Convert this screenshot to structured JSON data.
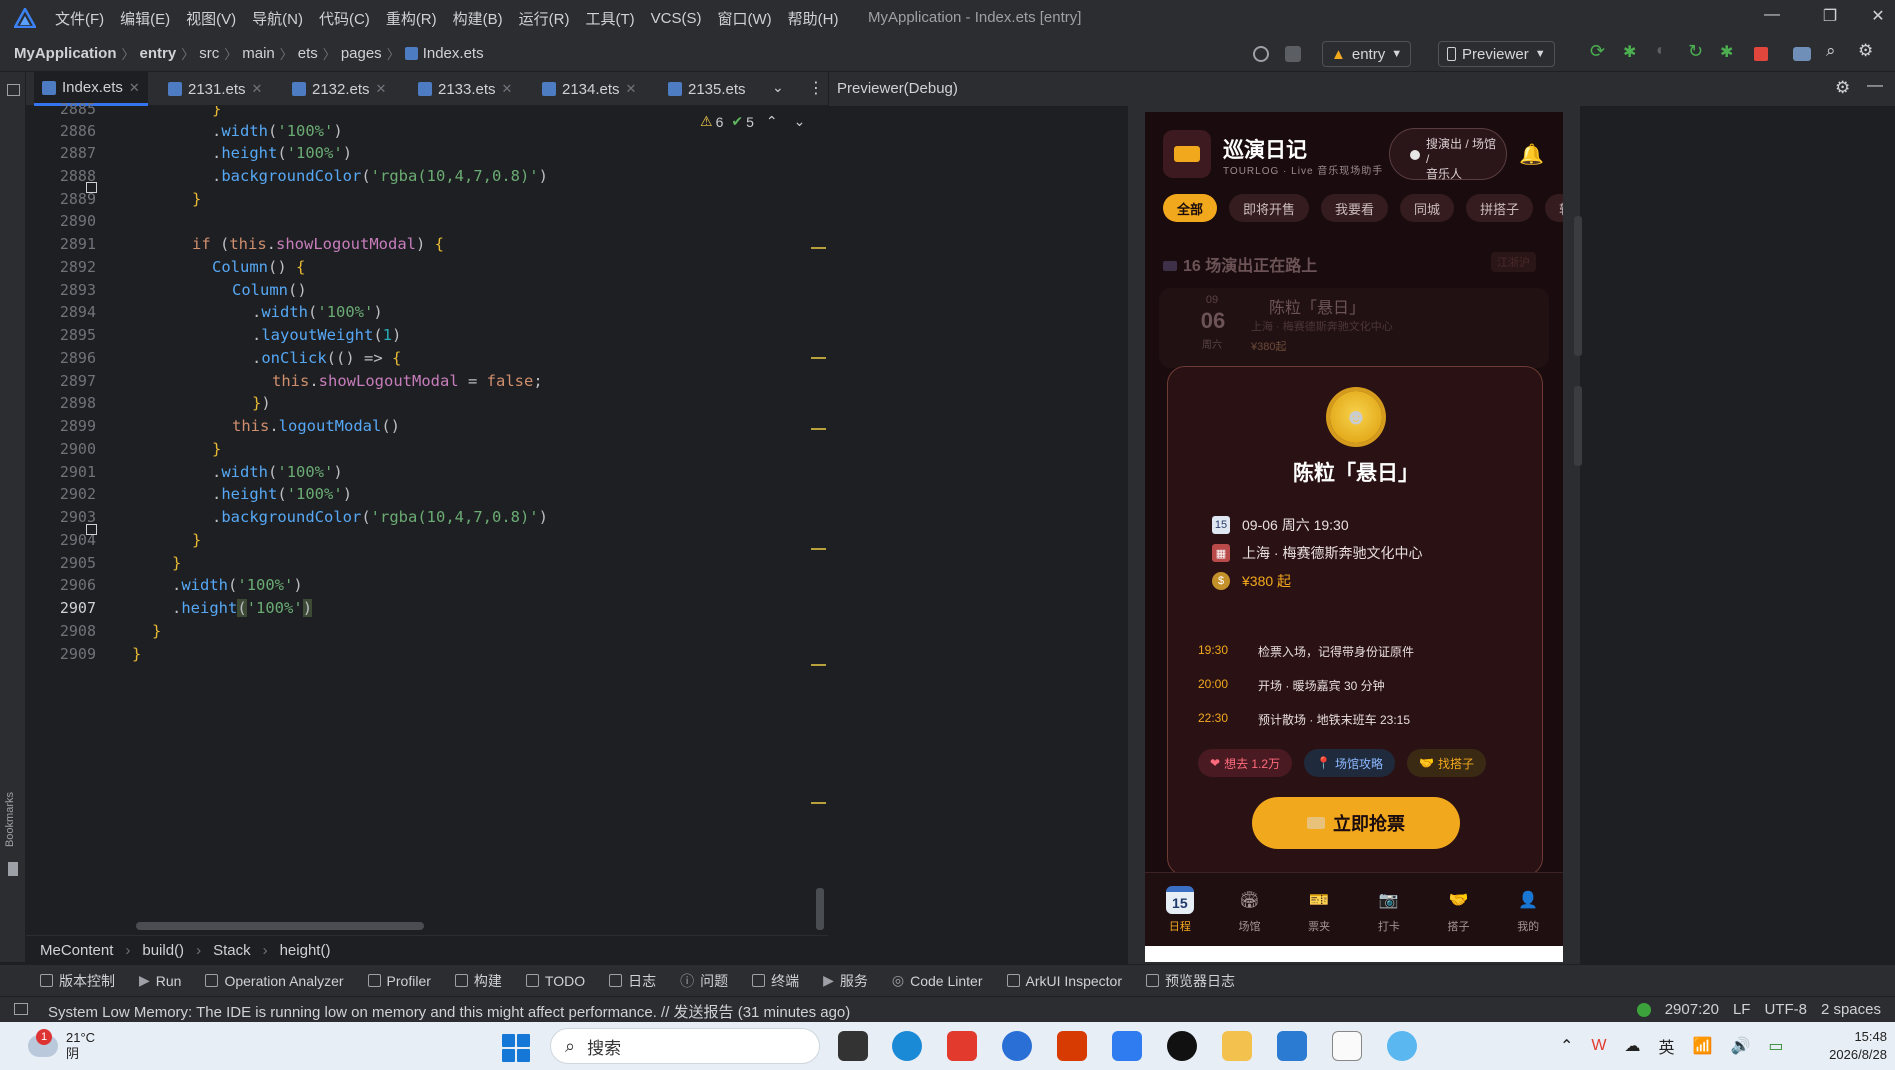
{
  "window": {
    "title": "MyApplication - Index.ets [entry]",
    "menus": [
      "文件(F)",
      "编辑(E)",
      "视图(V)",
      "导航(N)",
      "代码(C)",
      "重构(R)",
      "构建(B)",
      "运行(R)",
      "工具(T)",
      "VCS(S)",
      "窗口(W)",
      "帮助(H)"
    ]
  },
  "navbar": {
    "crumbs": [
      "MyApplication",
      "entry",
      "src",
      "main",
      "ets",
      "pages",
      "Index.ets"
    ],
    "module_select": "entry",
    "device_select": "Previewer"
  },
  "editor": {
    "tabs": [
      "Index.ets",
      "2131.ets",
      "2132.ets",
      "2133.ets",
      "2134.ets",
      "2135.ets"
    ],
    "active_tab": "Index.ets",
    "warnings": "6",
    "checks": "5",
    "line_numbers": [
      "2885",
      "2886",
      "2887",
      "2888",
      "2889",
      "2890",
      "2891",
      "2892",
      "2893",
      "2894",
      "2895",
      "2896",
      "2897",
      "2898",
      "2899",
      "2900",
      "2901",
      "2902",
      "2903",
      "2904",
      "2905",
      "2906",
      "2907",
      "2908",
      "2909"
    ],
    "current_line": "2907",
    "breadcrumbs": [
      "MeContent",
      "build()",
      "Stack",
      "height()"
    ]
  },
  "previewer": {
    "title": "Previewer(Debug)"
  },
  "app": {
    "name": "巡演日记",
    "subtitle": "TOURLOG · Live 音乐现场助手",
    "search_placeholder_1": "搜演出 / 场馆 /",
    "search_placeholder_2": "音乐人",
    "chips": [
      "全部",
      "即将开售",
      "我要看",
      "同城",
      "拼搭子",
      "转票"
    ],
    "on_road": "16 场演出正在路上",
    "on_road_tag": "江浙沪",
    "bg_card": {
      "month": "09",
      "day": "06",
      "weekday": "周六",
      "title": "陈粒「悬日」",
      "venue": "上海 · 梅赛德斯奔驰文化中心",
      "price": "¥380起"
    },
    "modal": {
      "title": "陈粒「悬日」",
      "datetime": "09-06 周六 19:30",
      "venue": "上海 · 梅赛德斯奔驰文化中心",
      "price": "¥380 起",
      "schedule": [
        {
          "time": "19:30",
          "text": "检票入场，记得带身份证原件"
        },
        {
          "time": "20:00",
          "text": "开场 · 暖场嘉宾 30 分钟"
        },
        {
          "time": "22:30",
          "text": "预计散场 · 地铁末班车 23:15"
        }
      ],
      "tags": [
        "想去 1.2万",
        "场馆攻略",
        "找搭子"
      ],
      "button": "立即抢票"
    },
    "tabbar": [
      {
        "label": "日程",
        "icon": "calendar-icon",
        "glyph": "15"
      },
      {
        "label": "场馆",
        "icon": "stadium-icon",
        "glyph": "🏟"
      },
      {
        "label": "票夹",
        "icon": "ticket-icon",
        "glyph": "🎫"
      },
      {
        "label": "打卡",
        "icon": "camera-icon",
        "glyph": "📷"
      },
      {
        "label": "搭子",
        "icon": "handshake-icon",
        "glyph": "🤝"
      },
      {
        "label": "我的",
        "icon": "user-icon",
        "glyph": "👤"
      }
    ]
  },
  "toolwindows": [
    "版本控制",
    "Run",
    "Operation Analyzer",
    "Profiler",
    "构建",
    "TODO",
    "日志",
    "问题",
    "终端",
    "服务",
    "Code Linter",
    "ArkUI Inspector",
    "预览器日志"
  ],
  "status": {
    "message": "System Low Memory: The IDE is running low on memory and this might affect performance. // 发送报告 (31 minutes ago)",
    "position": "2907:20",
    "line_sep": "LF",
    "encoding": "UTF-8",
    "indent": "2 spaces"
  },
  "taskbar": {
    "weather_badge": "1",
    "temp": "21°C",
    "weather": "阴",
    "search": "搜索",
    "ime": "英",
    "time": "15:48",
    "date": "2026/8/28"
  },
  "colors": {
    "accent": "#f2a81d",
    "ide_bg": "#1e1f22",
    "app_bg": "#1a0c0e"
  }
}
